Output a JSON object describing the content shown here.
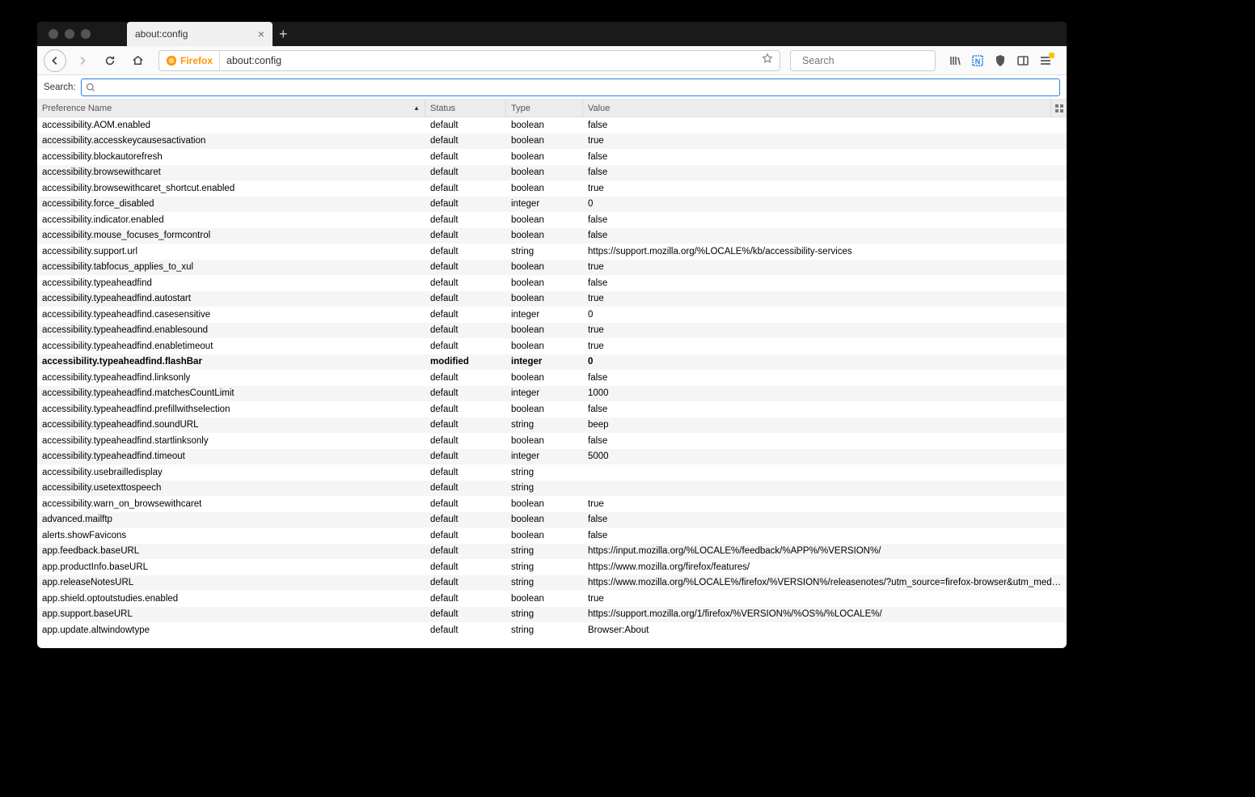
{
  "tab": {
    "title": "about:config"
  },
  "urlbar": {
    "prefix": "Firefox",
    "url": "about:config"
  },
  "toolbar_search": {
    "placeholder": "Search"
  },
  "config_search": {
    "label": "Search:"
  },
  "headers": {
    "pref": "Preference Name",
    "status": "Status",
    "type": "Type",
    "value": "Value"
  },
  "rows": [
    {
      "name": "accessibility.AOM.enabled",
      "status": "default",
      "type": "boolean",
      "value": "false",
      "mod": false
    },
    {
      "name": "accessibility.accesskeycausesactivation",
      "status": "default",
      "type": "boolean",
      "value": "true",
      "mod": false
    },
    {
      "name": "accessibility.blockautorefresh",
      "status": "default",
      "type": "boolean",
      "value": "false",
      "mod": false
    },
    {
      "name": "accessibility.browsewithcaret",
      "status": "default",
      "type": "boolean",
      "value": "false",
      "mod": false
    },
    {
      "name": "accessibility.browsewithcaret_shortcut.enabled",
      "status": "default",
      "type": "boolean",
      "value": "true",
      "mod": false
    },
    {
      "name": "accessibility.force_disabled",
      "status": "default",
      "type": "integer",
      "value": "0",
      "mod": false
    },
    {
      "name": "accessibility.indicator.enabled",
      "status": "default",
      "type": "boolean",
      "value": "false",
      "mod": false
    },
    {
      "name": "accessibility.mouse_focuses_formcontrol",
      "status": "default",
      "type": "boolean",
      "value": "false",
      "mod": false
    },
    {
      "name": "accessibility.support.url",
      "status": "default",
      "type": "string",
      "value": "https://support.mozilla.org/%LOCALE%/kb/accessibility-services",
      "mod": false
    },
    {
      "name": "accessibility.tabfocus_applies_to_xul",
      "status": "default",
      "type": "boolean",
      "value": "true",
      "mod": false
    },
    {
      "name": "accessibility.typeaheadfind",
      "status": "default",
      "type": "boolean",
      "value": "false",
      "mod": false
    },
    {
      "name": "accessibility.typeaheadfind.autostart",
      "status": "default",
      "type": "boolean",
      "value": "true",
      "mod": false
    },
    {
      "name": "accessibility.typeaheadfind.casesensitive",
      "status": "default",
      "type": "integer",
      "value": "0",
      "mod": false
    },
    {
      "name": "accessibility.typeaheadfind.enablesound",
      "status": "default",
      "type": "boolean",
      "value": "true",
      "mod": false
    },
    {
      "name": "accessibility.typeaheadfind.enabletimeout",
      "status": "default",
      "type": "boolean",
      "value": "true",
      "mod": false
    },
    {
      "name": "accessibility.typeaheadfind.flashBar",
      "status": "modified",
      "type": "integer",
      "value": "0",
      "mod": true
    },
    {
      "name": "accessibility.typeaheadfind.linksonly",
      "status": "default",
      "type": "boolean",
      "value": "false",
      "mod": false
    },
    {
      "name": "accessibility.typeaheadfind.matchesCountLimit",
      "status": "default",
      "type": "integer",
      "value": "1000",
      "mod": false
    },
    {
      "name": "accessibility.typeaheadfind.prefillwithselection",
      "status": "default",
      "type": "boolean",
      "value": "false",
      "mod": false
    },
    {
      "name": "accessibility.typeaheadfind.soundURL",
      "status": "default",
      "type": "string",
      "value": "beep",
      "mod": false
    },
    {
      "name": "accessibility.typeaheadfind.startlinksonly",
      "status": "default",
      "type": "boolean",
      "value": "false",
      "mod": false
    },
    {
      "name": "accessibility.typeaheadfind.timeout",
      "status": "default",
      "type": "integer",
      "value": "5000",
      "mod": false
    },
    {
      "name": "accessibility.usebrailledisplay",
      "status": "default",
      "type": "string",
      "value": "",
      "mod": false
    },
    {
      "name": "accessibility.usetexttospeech",
      "status": "default",
      "type": "string",
      "value": "",
      "mod": false
    },
    {
      "name": "accessibility.warn_on_browsewithcaret",
      "status": "default",
      "type": "boolean",
      "value": "true",
      "mod": false
    },
    {
      "name": "advanced.mailftp",
      "status": "default",
      "type": "boolean",
      "value": "false",
      "mod": false
    },
    {
      "name": "alerts.showFavicons",
      "status": "default",
      "type": "boolean",
      "value": "false",
      "mod": false
    },
    {
      "name": "app.feedback.baseURL",
      "status": "default",
      "type": "string",
      "value": "https://input.mozilla.org/%LOCALE%/feedback/%APP%/%VERSION%/",
      "mod": false
    },
    {
      "name": "app.productInfo.baseURL",
      "status": "default",
      "type": "string",
      "value": "https://www.mozilla.org/firefox/features/",
      "mod": false
    },
    {
      "name": "app.releaseNotesURL",
      "status": "default",
      "type": "string",
      "value": "https://www.mozilla.org/%LOCALE%/firefox/%VERSION%/releasenotes/?utm_source=firefox-browser&utm_medium=firefox-bro...",
      "mod": false
    },
    {
      "name": "app.shield.optoutstudies.enabled",
      "status": "default",
      "type": "boolean",
      "value": "true",
      "mod": false
    },
    {
      "name": "app.support.baseURL",
      "status": "default",
      "type": "string",
      "value": "https://support.mozilla.org/1/firefox/%VERSION%/%OS%/%LOCALE%/",
      "mod": false
    },
    {
      "name": "app.update.altwindowtype",
      "status": "default",
      "type": "string",
      "value": "Browser:About",
      "mod": false
    }
  ]
}
